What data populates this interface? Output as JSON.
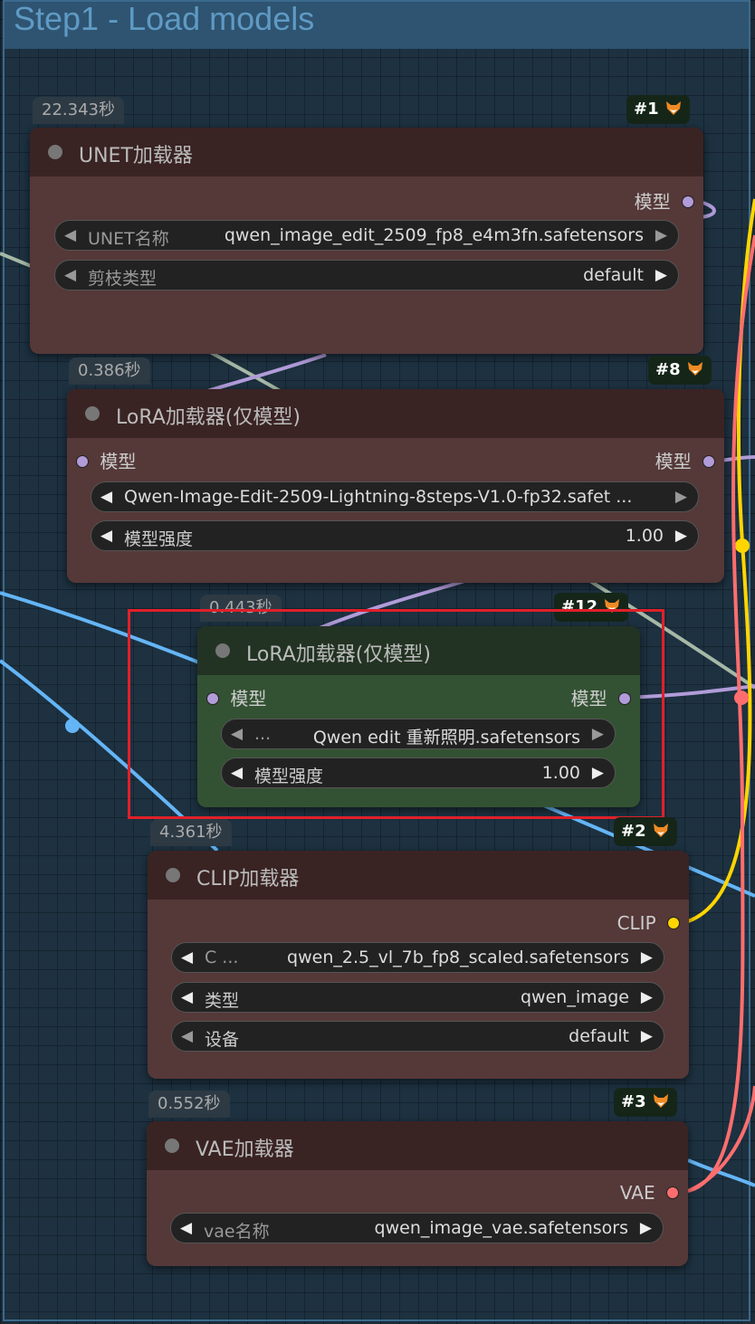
{
  "group": {
    "title": "Step1 - Load models"
  },
  "colors": {
    "model_wire": "#b19cd9",
    "clip_wire": "#ffd500",
    "vae_wire": "#ff6e6e",
    "image_wire": "#64b5f6",
    "other_wire": "#a6b8a6",
    "highlight": "#e0202a"
  },
  "nodes": [
    {
      "id": "#1",
      "timing": "22.343秒",
      "title": "UNET加载器",
      "outputs": [
        "模型"
      ],
      "widgets": [
        {
          "label": "UNET名称",
          "value": "qwen_image_edit_2509_fp8_e4m3fn.safetensors"
        },
        {
          "label": "剪枝类型",
          "value": "default"
        }
      ]
    },
    {
      "id": "#8",
      "timing": "0.386秒",
      "title": "LoRA加载器(仅模型)",
      "inputs": [
        "模型"
      ],
      "outputs": [
        "模型"
      ],
      "widgets": [
        {
          "label": "",
          "value": "Qwen-Image-Edit-2509-Lightning-8steps-V1.0-fp32.safet ..."
        },
        {
          "label": "模型强度",
          "value": "1.00"
        }
      ]
    },
    {
      "id": "#12",
      "timing": "0.443秒",
      "title": "LoRA加载器(仅模型)",
      "inputs": [
        "模型"
      ],
      "outputs": [
        "模型"
      ],
      "widgets": [
        {
          "label": "...",
          "value": "Qwen edit 重新照明.safetensors"
        },
        {
          "label": "模型强度",
          "value": "1.00"
        }
      ]
    },
    {
      "id": "#2",
      "timing": "4.361秒",
      "title": "CLIP加载器",
      "outputs": [
        "CLIP"
      ],
      "widgets": [
        {
          "label": "C ...",
          "value": "qwen_2.5_vl_7b_fp8_scaled.safetensors"
        },
        {
          "label": "类型",
          "value": "qwen_image"
        },
        {
          "label": "设备",
          "value": "default"
        }
      ]
    },
    {
      "id": "#3",
      "timing": "0.552秒",
      "title": "VAE加载器",
      "outputs": [
        "VAE"
      ],
      "widgets": [
        {
          "label": "vae名称",
          "value": "qwen_image_vae.safetensors"
        }
      ]
    }
  ],
  "icons": {
    "badge_icon": "fox-icon",
    "slot_icon": "connection-dot-icon"
  }
}
